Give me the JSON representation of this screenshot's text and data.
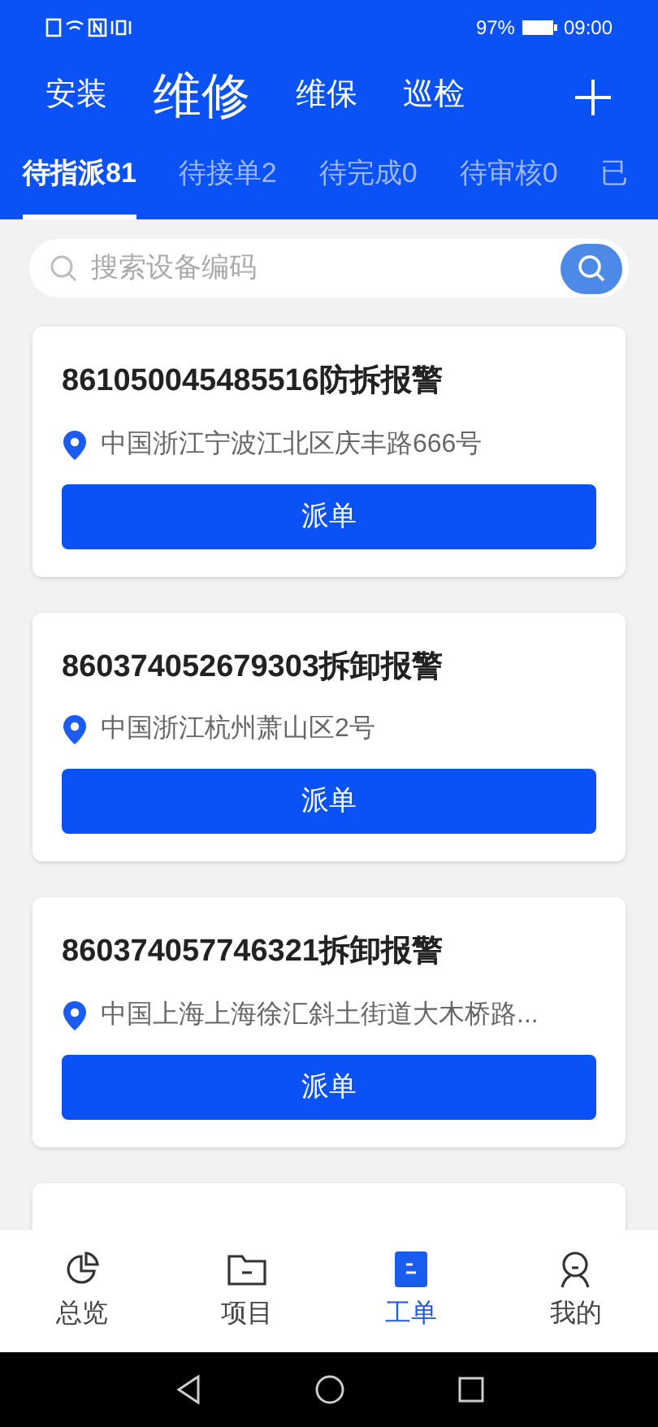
{
  "status_bar": {
    "battery": "97%",
    "time": "09:00"
  },
  "top_tabs": [
    {
      "label": "安装",
      "selected": false
    },
    {
      "label": "维修",
      "selected": true
    },
    {
      "label": "维保",
      "selected": false
    },
    {
      "label": "巡检",
      "selected": false
    }
  ],
  "sub_tabs": [
    {
      "label": "待指派81",
      "selected": true
    },
    {
      "label": "待接单2",
      "selected": false
    },
    {
      "label": "待完成0",
      "selected": false
    },
    {
      "label": "待审核0",
      "selected": false
    },
    {
      "label": "已",
      "selected": false
    }
  ],
  "search": {
    "placeholder": "搜索设备编码"
  },
  "orders": [
    {
      "title": "861050045485516防拆报警",
      "address": "中国浙江宁波江北区庆丰路666号",
      "button": "派单"
    },
    {
      "title": "860374052679303拆卸报警",
      "address": "中国浙江杭州萧山区2号",
      "button": "派单"
    },
    {
      "title": "860374057746321拆卸报警",
      "address": "中国上海上海徐汇斜土街道大木桥路...",
      "button": "派单"
    }
  ],
  "bottom_nav": [
    {
      "label": "总览",
      "kind": "chart",
      "selected": false
    },
    {
      "label": "项目",
      "kind": "folder",
      "selected": false
    },
    {
      "label": "工单",
      "kind": "doc",
      "selected": true
    },
    {
      "label": "我的",
      "kind": "user",
      "selected": false
    }
  ]
}
